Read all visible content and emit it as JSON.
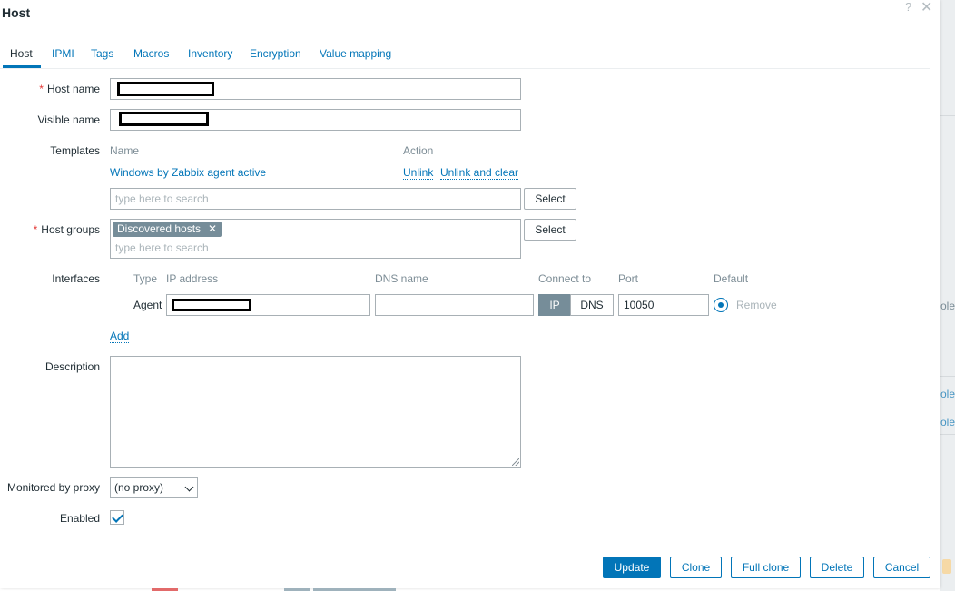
{
  "dialog": {
    "title": "Host",
    "help_glyph": "?",
    "close_glyph": "✕"
  },
  "tabs": [
    {
      "label": "Host",
      "active": true
    },
    {
      "label": "IPMI"
    },
    {
      "label": "Tags"
    },
    {
      "label": "Macros"
    },
    {
      "label": "Inventory"
    },
    {
      "label": "Encryption"
    },
    {
      "label": "Value mapping"
    }
  ],
  "form": {
    "required_marker": "*",
    "host_name_label": "Host name",
    "visible_name_label": "Visible name",
    "templates": {
      "label": "Templates",
      "col_name": "Name",
      "col_action": "Action",
      "linked_template": "Windows by Zabbix agent active",
      "unlink": "Unlink",
      "unlink_clear": "Unlink and clear",
      "search_placeholder": "type here to search",
      "select_button": "Select"
    },
    "host_groups": {
      "label": "Host groups",
      "chip": "Discovered hosts",
      "chip_remove": "✕",
      "search_placeholder": "type here to search",
      "select_button": "Select"
    },
    "interfaces": {
      "label": "Interfaces",
      "col_type": "Type",
      "col_ip": "IP address",
      "col_dns": "DNS name",
      "col_connect": "Connect to",
      "col_port": "Port",
      "col_default": "Default",
      "row_type": "Agent",
      "connect_ip": "IP",
      "connect_dns": "DNS",
      "port": "10050",
      "remove": "Remove",
      "add": "Add"
    },
    "description_label": "Description",
    "proxy": {
      "label": "Monitored by proxy",
      "value": "(no proxy)"
    },
    "enabled_label": "Enabled"
  },
  "footer": {
    "update": "Update",
    "clone": "Clone",
    "full_clone": "Full clone",
    "delete": "Delete",
    "cancel": "Cancel"
  },
  "background": {
    "frag1": "ole",
    "frag2": "ole",
    "frag3": "ole"
  }
}
